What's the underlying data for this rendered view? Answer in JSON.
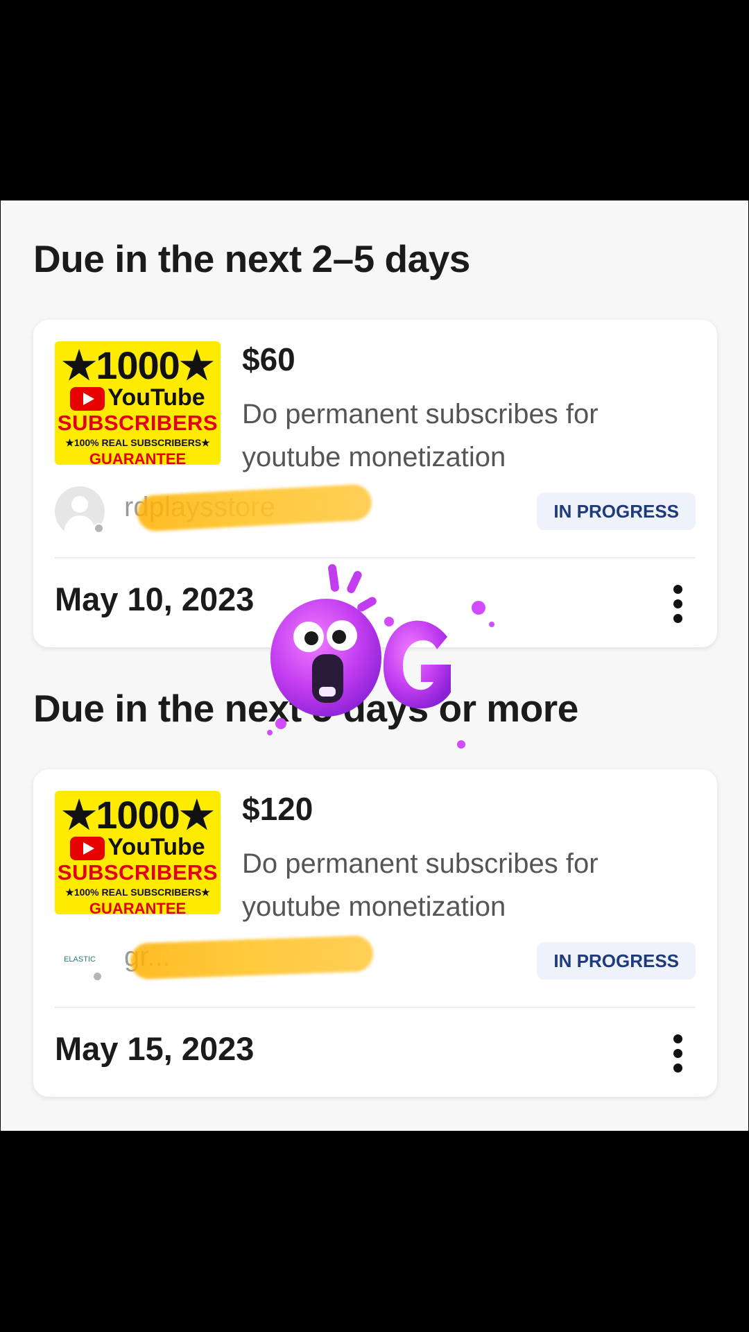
{
  "sections": [
    {
      "title": "Due in the next 2–5 days",
      "order": {
        "thumbnail": {
          "count": "★1000★",
          "platform": "YouTube",
          "subscribers": "SUBSCRIBERS",
          "tagline": "★100% REAL SUBSCRIBERS★",
          "guarantee": "GUARANTEE"
        },
        "price": "$60",
        "description": "Do permanent subscribes for youtube monetization",
        "username": "rdplaysstore",
        "status": "IN PROGRESS",
        "due_date": "May 10, 2023"
      }
    },
    {
      "title": "Due in the next 5 days or more",
      "order": {
        "thumbnail": {
          "count": "★1000★",
          "platform": "YouTube",
          "subscribers": "SUBSCRIBERS",
          "tagline": "★100% REAL SUBSCRIBERS★",
          "guarantee": "GUARANTEE"
        },
        "avatar_text": "ELASTIC",
        "price": "$120",
        "description": "Do permanent subscribes for youtube monetization",
        "username": "gr...",
        "status": "IN PROGRESS",
        "due_date": "May 15, 2023"
      }
    }
  ],
  "colors": {
    "badge_bg": "#eef2fb",
    "badge_text": "#1f3a7a",
    "thumb_bg": "#ffeb00",
    "sticker_purple": "#c23cf0"
  },
  "icons": [
    "kebab-menu-icon",
    "default-avatar-icon",
    "youtube-play-icon",
    "omg-sticker"
  ]
}
